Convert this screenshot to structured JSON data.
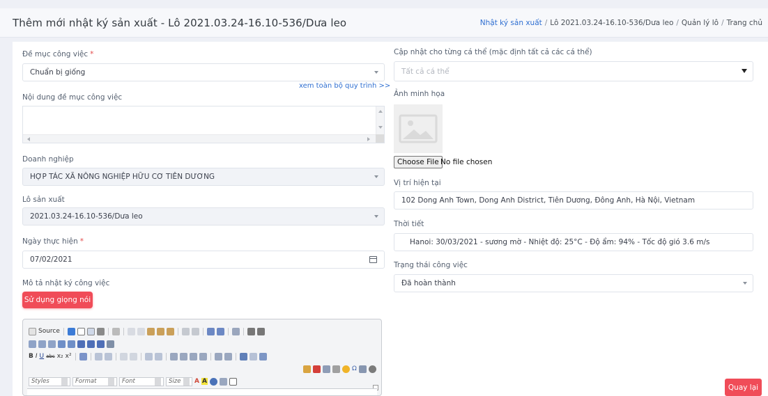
{
  "header": {
    "title": "Thêm mới nhật ký sản xuất - Lô 2021.03.24-16.10-536/Dưa leo",
    "breadcrumb": [
      "Nhật ký sản xuất",
      "Lô 2021.03.24-16.10-536/Dưa leo",
      "Quản lý lô",
      "Trang chủ"
    ]
  },
  "form": {
    "task_heading": {
      "label": "Đề mục công việc",
      "required": "*",
      "value": "Chuẩn bị giống"
    },
    "view_process_link": "xem toàn bộ quy trình >>",
    "task_content": {
      "label": "Nội dung đề mục công việc",
      "value": ""
    },
    "enterprise": {
      "label": "Doanh nghiệp",
      "value": "HỢP TÁC XÃ NÔNG NGHIỆP HỮU CƠ TIÊN DƯƠNG"
    },
    "production_lot": {
      "label": "Lô sản xuất",
      "value": "2021.03.24-16.10-536/Dưa leo"
    },
    "execution_date": {
      "label": "Ngày thực hiện",
      "required": "*",
      "value": "07/02/2021"
    },
    "log_description": {
      "label": "Mô tả nhật ký công việc"
    },
    "voice_button": "Sử dụng giọng nói",
    "update_individual": {
      "label": "Cập nhật cho từng cá thể (mặc định tất cả các cá thể)",
      "placeholder": "Tất cả cá thể"
    },
    "illustration": {
      "label": "Ảnh minh họa"
    },
    "file_input": {
      "button": "Choose File",
      "status": "No file chosen"
    },
    "current_location": {
      "label": "Vị trí hiện tại",
      "value": "102 Dong Anh Town, Dong Anh District, Tiên Dương, Đông Anh, Hà Nội, Vietnam"
    },
    "weather": {
      "label": "Thời tiết",
      "value": "Hanoi: 30/03/2021 -  sương mờ - Nhiệt độ: 25°C - Độ ẩm: 94% - Tốc độ gió 3.6 m/s"
    },
    "task_status": {
      "label": "Trạng thái công việc",
      "value": "Đã hoàn thành"
    },
    "back_button": "Quay lại"
  },
  "editor": {
    "source_label": "Source",
    "styles_combo": "Styles",
    "format_combo": "Format",
    "font_combo": "Font",
    "size_combo": "Size"
  },
  "colors": {
    "accent_red": "#f04c58",
    "link_blue": "#2f6fd1",
    "required_red": "#e34b4b"
  }
}
